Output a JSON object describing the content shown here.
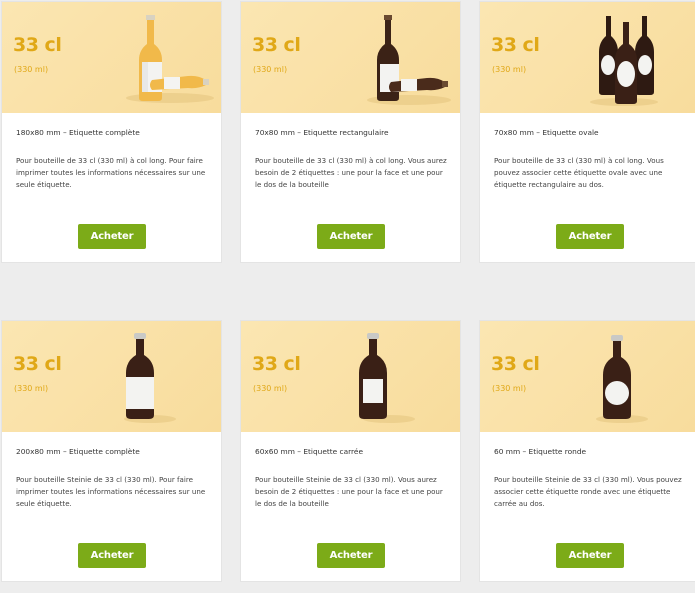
{
  "cards": [
    {
      "volume": "33 cl",
      "volume_ml": "(330 ml)",
      "title": "180x80 mm – Etiquette complète",
      "description": "Pour bouteille de 33 cl (330 ml) à col long. Pour faire imprimer toutes les informations nécessaires sur une seule étiquette.",
      "button": "Acheter"
    },
    {
      "volume": "33 cl",
      "volume_ml": "(330 ml)",
      "title": "70x80 mm – Etiquette rectangulaire",
      "description": "Pour bouteille de 33 cl (330 ml) à col long. Vous aurez besoin de 2 étiquettes : une pour la face et une pour le dos de la bouteille",
      "button": "Acheter"
    },
    {
      "volume": "33 cl",
      "volume_ml": "(330 ml)",
      "title": "70x80 mm – Etiquette ovale",
      "description": "Pour bouteille de 33 cl (330 ml) à col long. Vous pouvez associer cette étiquette ovale avec une étiquette rectangulaire au dos.",
      "button": "Acheter"
    },
    {
      "volume": "33 cl",
      "volume_ml": "(330 ml)",
      "title": "200x80 mm – Etiquette complète",
      "description": "Pour bouteille Steinie de 33 cl (330 ml). Pour faire imprimer toutes les informations nécessaires sur une seule étiquette.",
      "button": "Acheter"
    },
    {
      "volume": "33 cl",
      "volume_ml": "(330 ml)",
      "title": "60x60 mm – Etiquette carrée",
      "description": "Pour bouteille Steinie de 33 cl (330 ml). Vous aurez besoin de 2 étiquettes : une pour la face et une pour le dos de la bouteille",
      "button": "Acheter"
    },
    {
      "volume": "33 cl",
      "volume_ml": "(330 ml)",
      "title": "60 mm – Etiquette ronde",
      "description": "Pour bouteille Steinie de 33 cl (330 ml). Vous pouvez associer cette étiquette ronde avec une étiquette carrée au dos.",
      "button": "Acheter"
    }
  ],
  "colors": {
    "accent": "#e0a817",
    "button": "#7cab18",
    "hero_bg": "#f9dfa2",
    "page_bg": "#ededed"
  }
}
